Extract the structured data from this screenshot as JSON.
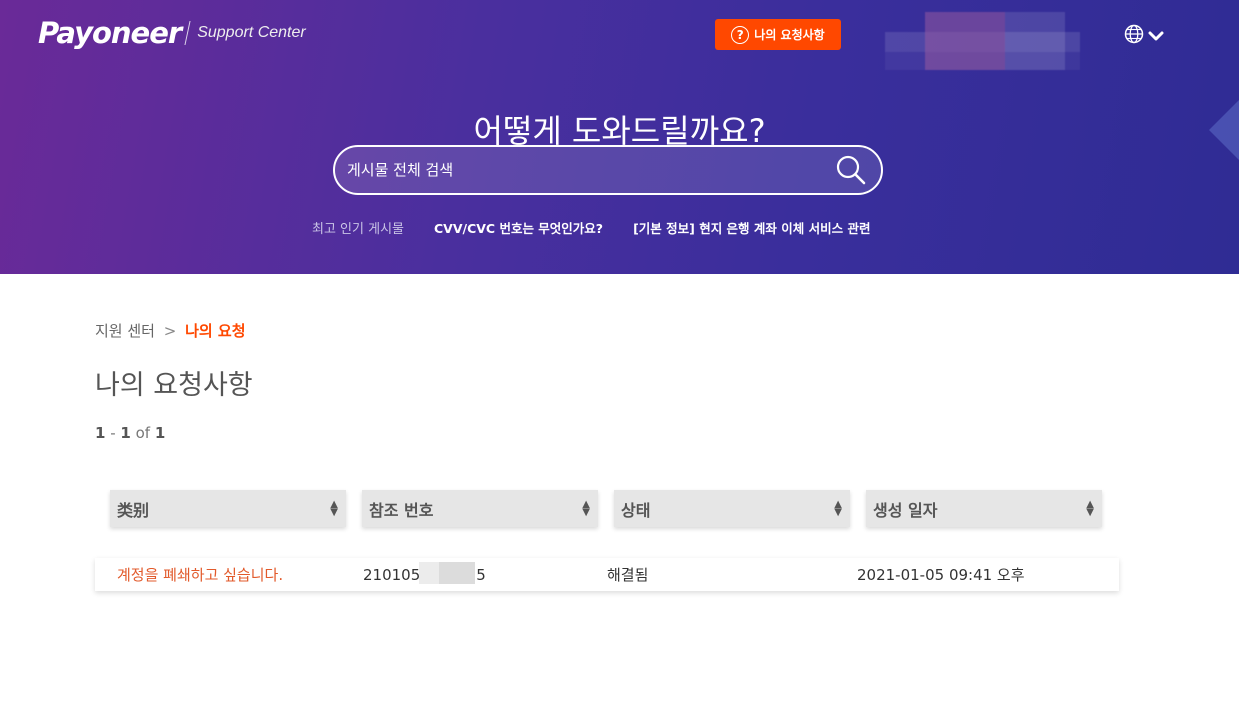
{
  "header": {
    "logo_text": "Payoneer",
    "logo_subtitle": "Support Center",
    "my_requests_button": "나의 요청사항",
    "accent_color": "#ff4800"
  },
  "hero": {
    "title": "어떻게 도와드릴까요?",
    "search_placeholder": "게시물 전체 검색",
    "popular_label": "최고 인기 게시물",
    "popular_links": [
      "CVV/CVC 번호는 무엇인가요?",
      "[기본 정보] 현지 은행 계좌 이체 서비스 관련"
    ]
  },
  "breadcrumb": {
    "root": "지원 센터",
    "separator": ">",
    "current": "나의 요청"
  },
  "page_title": "나의 요청사항",
  "pager": {
    "start": "1",
    "end": "1",
    "of": "of",
    "total": "1"
  },
  "table": {
    "columns": [
      "类别",
      "참조 번호",
      "상태",
      "생성 일자"
    ],
    "rows": [
      {
        "subject": "계정을 폐쇄하고 싶습니다.",
        "reference": "210105",
        "reference_suffix": "5",
        "status": "해결됨",
        "created": "2021-01-05 09:41 오후"
      }
    ]
  }
}
